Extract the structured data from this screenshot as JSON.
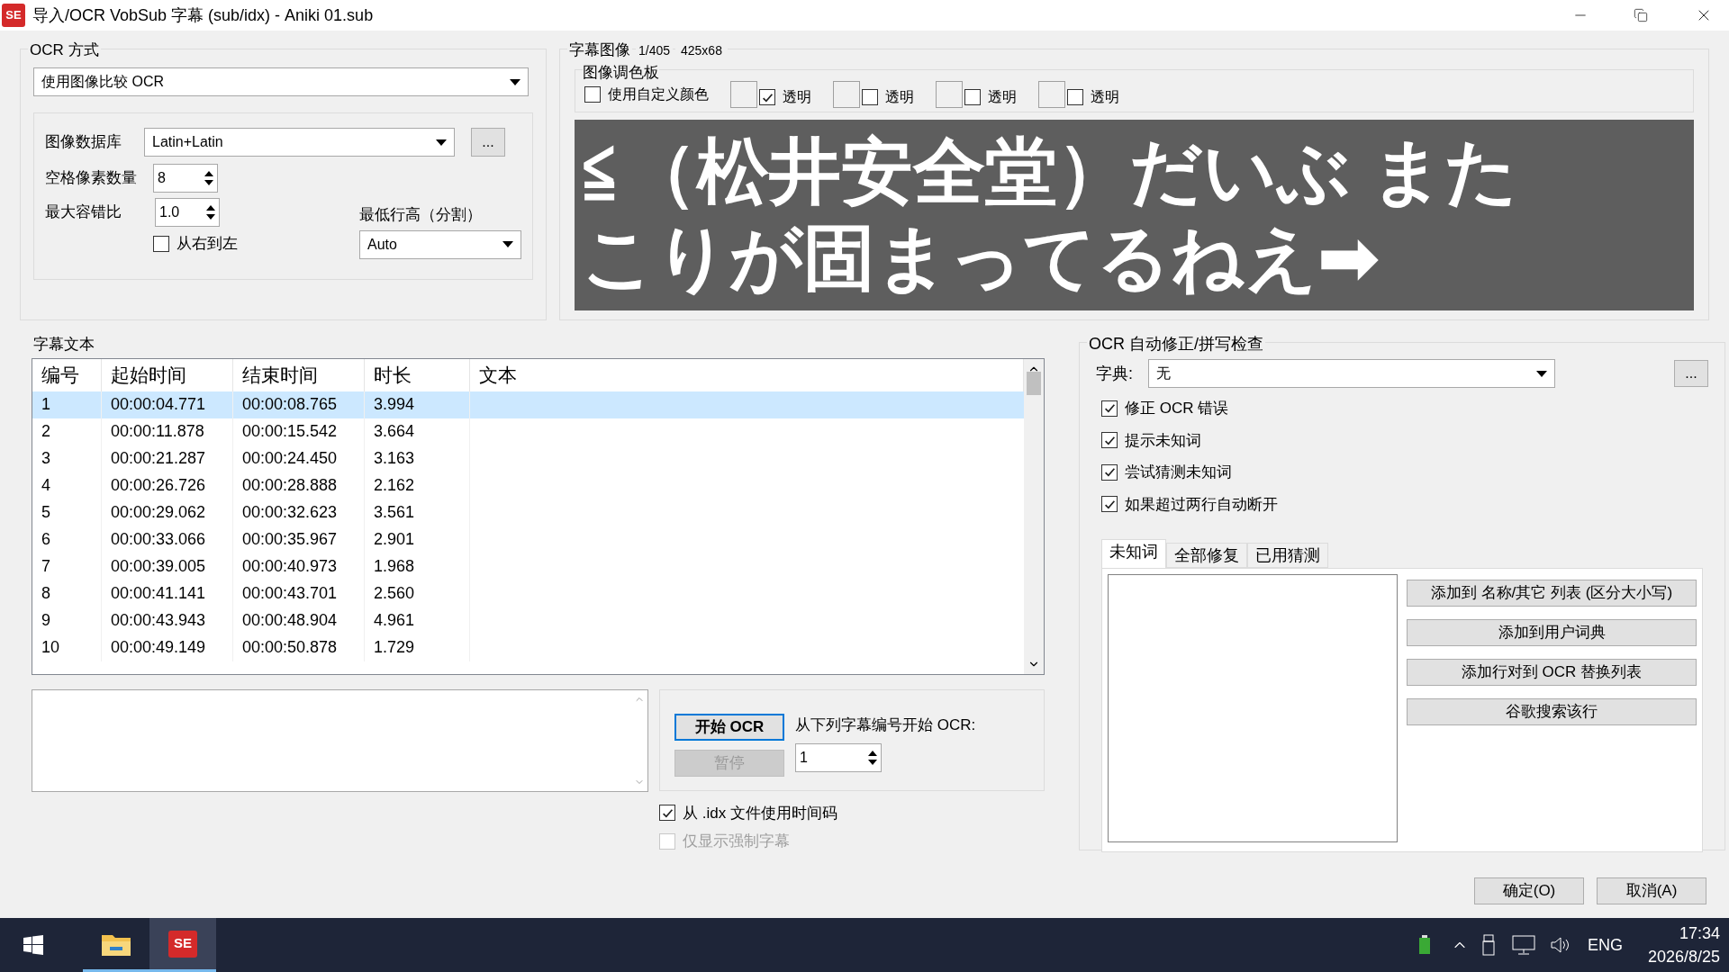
{
  "window": {
    "logo": "SE",
    "title": "导入/OCR VobSub 字幕 (sub/idx) - Aniki 01.sub"
  },
  "ocr_method": {
    "label": "OCR 方式",
    "method": "使用图像比较 OCR",
    "database_label": "图像数据库",
    "database": "Latin+Latin",
    "browse": "...",
    "space_pixels_label": "空格像素数量",
    "space_pixels": "8",
    "max_error_label": "最大容错比",
    "max_error": "1.0",
    "rtl": {
      "label": "从右到左",
      "checked": false
    },
    "min_line_height_label": "最低行高（分割）",
    "min_line_height": "Auto"
  },
  "subtitle_image": {
    "label": "字幕图像",
    "index": "1/405",
    "size": "425x68",
    "palette_label": "图像调色板",
    "custom_colors": {
      "label": "使用自定义颜色",
      "checked": false
    },
    "palette": [
      {
        "label": "透明",
        "checked": true
      },
      {
        "label": "透明",
        "checked": false
      },
      {
        "label": "透明",
        "checked": false
      },
      {
        "label": "透明",
        "checked": false
      }
    ],
    "lines": [
      "≦（松井安全堂）だいぶ また",
      "こりが固まってるねえ➡"
    ]
  },
  "subtitles": {
    "label": "字幕文本",
    "columns": [
      "编号",
      "起始时间",
      "结束时间",
      "时长",
      "文本"
    ],
    "rows": [
      {
        "cells": [
          "1",
          "00:00:04.771",
          "00:00:08.765",
          "3.994"
        ],
        "selected": true
      },
      {
        "cells": [
          "2",
          "00:00:11.878",
          "00:00:15.542",
          "3.664"
        ],
        "selected": false
      },
      {
        "cells": [
          "3",
          "00:00:21.287",
          "00:00:24.450",
          "3.163"
        ],
        "selected": false
      },
      {
        "cells": [
          "4",
          "00:00:26.726",
          "00:00:28.888",
          "2.162"
        ],
        "selected": false
      },
      {
        "cells": [
          "5",
          "00:00:29.062",
          "00:00:32.623",
          "3.561"
        ],
        "selected": false
      },
      {
        "cells": [
          "6",
          "00:00:33.066",
          "00:00:35.967",
          "2.901"
        ],
        "selected": false
      },
      {
        "cells": [
          "7",
          "00:00:39.005",
          "00:00:40.973",
          "1.968"
        ],
        "selected": false
      },
      {
        "cells": [
          "8",
          "00:00:41.141",
          "00:00:43.701",
          "2.560"
        ],
        "selected": false
      },
      {
        "cells": [
          "9",
          "00:00:43.943",
          "00:00:48.904",
          "4.961"
        ],
        "selected": false
      },
      {
        "cells": [
          "10",
          "00:00:49.149",
          "00:00:50.878",
          "1.729"
        ],
        "selected": false
      }
    ]
  },
  "ocr_run": {
    "start": "开始 OCR",
    "pause": {
      "label": "暂停",
      "disabled": true
    },
    "from_label": "从下列字幕编号开始 OCR:",
    "from": "1",
    "options": [
      {
        "label": "从 .idx 文件使用时间码",
        "checked": true,
        "disabled": false
      },
      {
        "label": "仅显示强制字幕",
        "checked": false,
        "disabled": true
      }
    ]
  },
  "autocorrect": {
    "label": "OCR 自动修正/拼写检查",
    "dictionary_label": "字典:",
    "dictionary": "无",
    "browse": "...",
    "options": [
      {
        "label": "修正 OCR 错误",
        "checked": true
      },
      {
        "label": "提示未知词",
        "checked": true
      },
      {
        "label": "尝试猜测未知词",
        "checked": true
      },
      {
        "label": "如果超过两行自动断开",
        "checked": true
      }
    ],
    "tabs": [
      {
        "label": "未知词",
        "selected": true
      },
      {
        "label": "全部修复",
        "selected": false
      },
      {
        "label": "已用猜测",
        "selected": false
      }
    ],
    "actions": [
      "添加到 名称/其它 列表 (区分大小写)",
      "添加到用户词典",
      "添加行对到 OCR 替换列表",
      "谷歌搜索该行"
    ]
  },
  "buttons": [
    "确定(O)",
    "取消(A)"
  ],
  "taskbar": {
    "apps": [
      {
        "kind": "folder",
        "active": false
      },
      {
        "kind": "logo",
        "label": "SE",
        "active": true
      }
    ],
    "language": "ENG",
    "time": "17:34",
    "date": "2026/8/25"
  }
}
